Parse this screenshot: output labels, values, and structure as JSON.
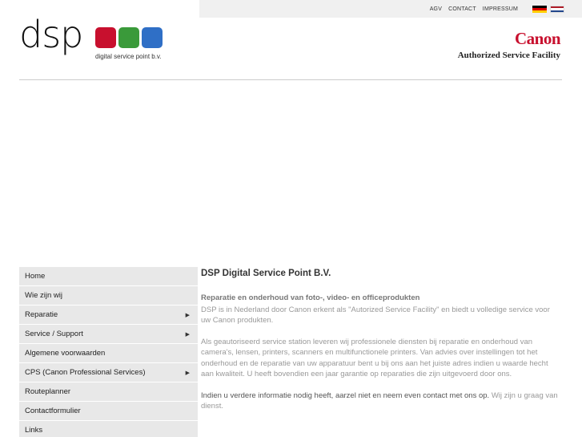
{
  "top_nav": {
    "links": [
      "AGV",
      "CONTACT",
      "IMPRESSUM"
    ],
    "flags": [
      {
        "name": "german",
        "colors": [
          "#000000",
          "#dd0000",
          "#ffce00"
        ]
      },
      {
        "name": "dutch",
        "colors": [
          "#ae1c28",
          "#ffffff",
          "#21468b"
        ]
      }
    ]
  },
  "logo": {
    "text": "dsp",
    "subtitle": "digital service point b.v.",
    "square_colors": [
      "#c8102e",
      "#3a9a3a",
      "#2f6fc6"
    ]
  },
  "partner": {
    "brand": "Canon",
    "tagline": "Authorized Service Facility"
  },
  "sidebar": {
    "items": [
      {
        "label": "Home",
        "has_submenu": false
      },
      {
        "label": "Wie zijn wij",
        "has_submenu": false
      },
      {
        "label": "Reparatie",
        "has_submenu": true
      },
      {
        "label": "Service / Support",
        "has_submenu": true
      },
      {
        "label": "Algemene voorwaarden",
        "has_submenu": false
      },
      {
        "label": "CPS (Canon Professional Services)",
        "has_submenu": true
      },
      {
        "label": "Routeplanner",
        "has_submenu": false
      },
      {
        "label": "Contactformulier",
        "has_submenu": false
      },
      {
        "label": "Links",
        "has_submenu": false
      }
    ]
  },
  "content": {
    "title": "DSP Digital Service Point B.V.",
    "subtitle": "Reparatie en onderhoud van foto-, video- en officeprodukten",
    "p1": "DSP is in Nederland door Canon erkent als \"Autorized Service Facility\" en biedt u volledige service voor uw Canon produkten.",
    "p2": "Als geautoriseerd service station leveren wij professionele diensten bij reparatie en onderhoud van camera's, lensen, printers, scanners en multifunctionele printers. Van advies over instellingen tot het onderhoud en de reparatie van uw apparatuur bent u bij ons aan het juiste adres indien u waarde hecht aan kwaliteit. U heeft bovendien een jaar garantie op reparaties die zijn uitgevoerd door ons.",
    "p3_dark": "Indien u verdere informatie nodig heeft, aarzel niet en neem even contact met ons op.",
    "p3_link": "Wij zijn u graag van dienst."
  }
}
